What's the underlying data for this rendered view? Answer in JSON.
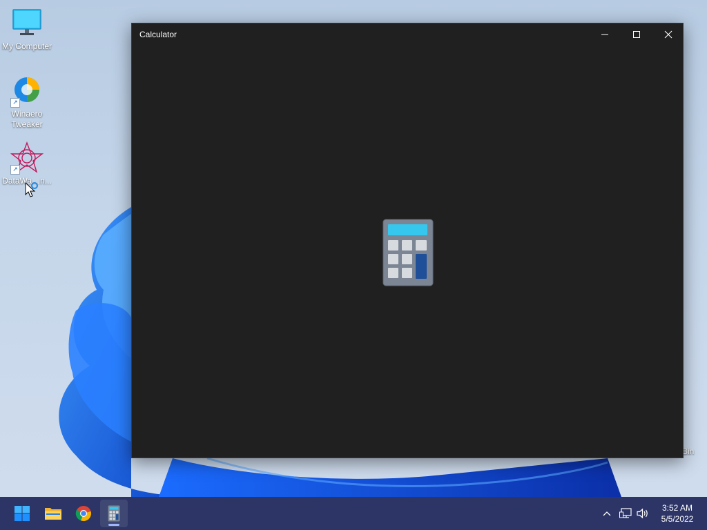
{
  "desktop": {
    "icons": [
      {
        "label": "My Computer"
      },
      {
        "label": "Winaero Tweaker"
      },
      {
        "label": "DataWa…n..."
      }
    ],
    "recycle_bin_partial_label": "Bin"
  },
  "window": {
    "title": "Calculator",
    "controls": {
      "minimize": "minimize-icon",
      "maximize": "maximize-icon",
      "close": "close-icon"
    },
    "splash_icon": "calculator-icon"
  },
  "taskbar": {
    "apps": [
      {
        "name": "start-icon"
      },
      {
        "name": "file-explorer-icon"
      },
      {
        "name": "chrome-icon"
      },
      {
        "name": "calculator-icon",
        "active": true
      }
    ],
    "tray": {
      "icons": [
        "chevron-up-icon",
        "network-icon",
        "volume-icon"
      ],
      "time": "3:52 AM",
      "date": "5/5/2022"
    }
  },
  "colors": {
    "window_bg": "#202020",
    "taskbar_bg": "#2c3566",
    "accent": "#0078d4"
  }
}
